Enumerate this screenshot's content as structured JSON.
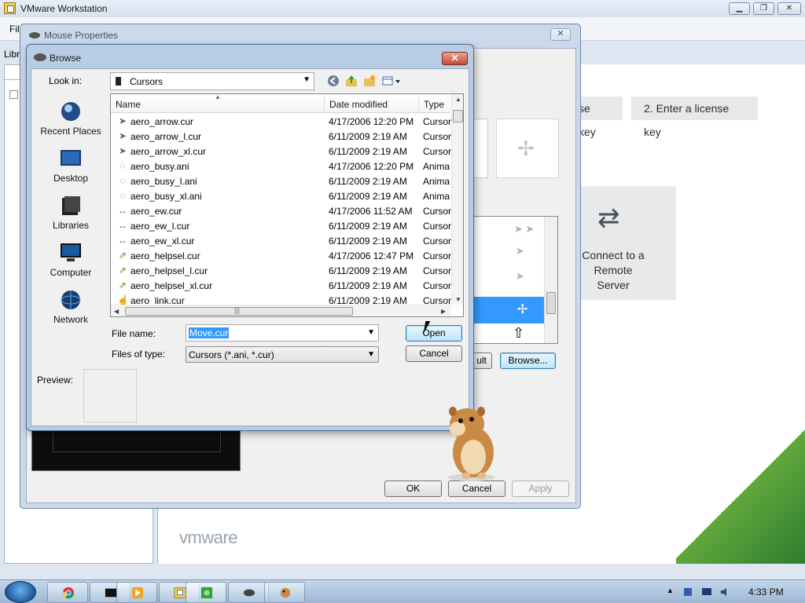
{
  "vmware": {
    "title": "VMware Workstation",
    "menu_file": "Fil",
    "library_label": "Libr",
    "buttons": [
      "se key",
      "2. Enter a license key"
    ],
    "connect_label": "Connect to a Remote Server",
    "logo": "vmware"
  },
  "mouse_props": {
    "title": "Mouse Properties",
    "use_default_label": "ult",
    "browse_label": "Browse...",
    "ok_label": "OK",
    "cancel_label": "Cancel",
    "apply_label": "Apply"
  },
  "browse": {
    "title": "Browse",
    "look_in_label": "Look in:",
    "look_in_value": "Cursors",
    "places": [
      {
        "label": "Recent Places",
        "icon": "recent-places-icon"
      },
      {
        "label": "Desktop",
        "icon": "desktop-icon"
      },
      {
        "label": "Libraries",
        "icon": "libraries-icon"
      },
      {
        "label": "Computer",
        "icon": "computer-icon"
      },
      {
        "label": "Network",
        "icon": "network-icon"
      }
    ],
    "columns": {
      "name": "Name",
      "date": "Date modified",
      "type": "Type"
    },
    "files": [
      {
        "name": "aero_arrow.cur",
        "date": "4/17/2006 12:20 PM",
        "type": "Cursor"
      },
      {
        "name": "aero_arrow_l.cur",
        "date": "6/11/2009 2:19 AM",
        "type": "Cursor"
      },
      {
        "name": "aero_arrow_xl.cur",
        "date": "6/11/2009 2:19 AM",
        "type": "Cursor"
      },
      {
        "name": "aero_busy.ani",
        "date": "4/17/2006 12:20 PM",
        "type": "Anima"
      },
      {
        "name": "aero_busy_l.ani",
        "date": "6/11/2009 2:19 AM",
        "type": "Anima"
      },
      {
        "name": "aero_busy_xl.ani",
        "date": "6/11/2009 2:19 AM",
        "type": "Anima"
      },
      {
        "name": "aero_ew.cur",
        "date": "4/17/2006 11:52 AM",
        "type": "Cursor"
      },
      {
        "name": "aero_ew_l.cur",
        "date": "6/11/2009 2:19 AM",
        "type": "Cursor"
      },
      {
        "name": "aero_ew_xl.cur",
        "date": "6/11/2009 2:19 AM",
        "type": "Cursor"
      },
      {
        "name": "aero_helpsel.cur",
        "date": "4/17/2006 12:47 PM",
        "type": "Cursor"
      },
      {
        "name": "aero_helpsel_l.cur",
        "date": "6/11/2009 2:19 AM",
        "type": "Cursor"
      },
      {
        "name": "aero_helpsel_xl.cur",
        "date": "6/11/2009 2:19 AM",
        "type": "Cursor"
      },
      {
        "name": "aero_link.cur",
        "date": "6/11/2009 2:19 AM",
        "type": "Cursor"
      }
    ],
    "file_name_label": "File name:",
    "file_name_value": "Move.cur",
    "files_of_type_label": "Files of type:",
    "files_of_type_value": "Cursors (*.ani, *.cur)",
    "open_label": "Open",
    "cancel_label": "Cancel",
    "preview_label": "Preview:"
  },
  "taskbar": {
    "clock": "4:33 PM",
    "apps": [
      "chrome-icon",
      "terminal-icon",
      "media-player-icon",
      "vmware-icon",
      "green-app-icon",
      "mouse-icon",
      "hamster-icon"
    ]
  },
  "colors": {
    "selection": "#3399ff",
    "vmware_green": "#5fa83a",
    "close_red": "#c54a36"
  }
}
